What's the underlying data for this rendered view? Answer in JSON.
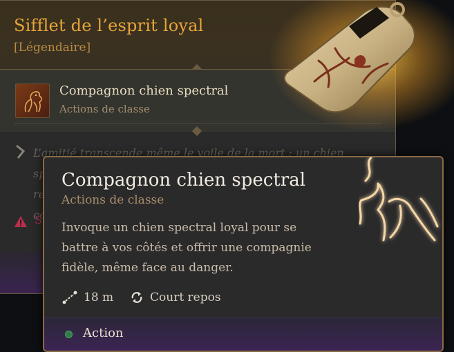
{
  "item": {
    "title": "Sifflet de l’esprit loyal",
    "rarity": "[Légendaire]",
    "spell_name": "Compagnon chien spectral",
    "spell_class": "Actions de classe",
    "flavor_line1": "L’amitié transcende même le voile de la mort : un chien spectral",
    "flavor_line2": "re",
    "flavor_line3": "co",
    "warning_text": "S",
    "accent_color": "#e7a63a",
    "warning_color": "#a83050"
  },
  "spell_tooltip": {
    "title": "Compagnon chien spectral",
    "class": "Actions de classe",
    "description": "Invoque un chien spectral loyal pour se battre à vos côtés et offrir une compagnie fidèle, même face au danger.",
    "range": "18 m",
    "recharge": "Court repos",
    "cost": "Action",
    "cost_color": "#2f7a48"
  },
  "icons": {
    "range": "range-icon",
    "recharge": "short-rest-icon",
    "action": "action-dot-icon",
    "flavor": "quote-icon",
    "warning": "warning-icon",
    "spell": "spectral-hound-icon",
    "item": "whistle-icon"
  }
}
